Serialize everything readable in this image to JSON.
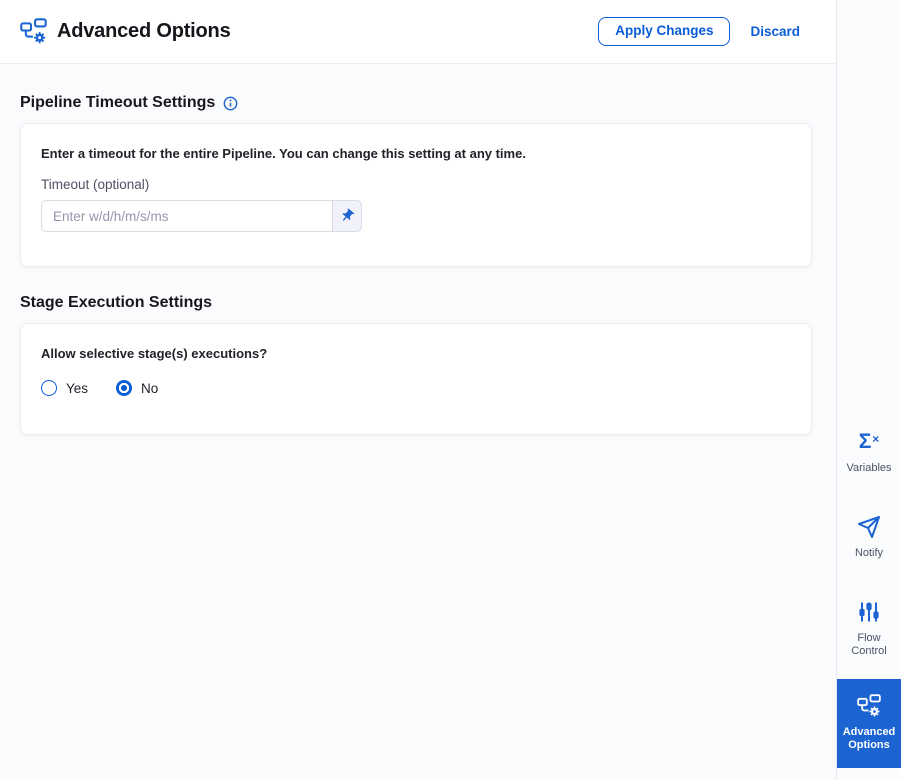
{
  "header": {
    "title": "Advanced Options",
    "icon": "pipeline-gear-icon",
    "apply_label": "Apply Changes",
    "discard_label": "Discard"
  },
  "pipeline_timeout": {
    "heading": "Pipeline Timeout Settings",
    "info_icon": "info-icon",
    "description": "Enter a timeout for the entire Pipeline. You can change this setting at any time.",
    "timeout_label": "Timeout (optional)",
    "timeout_placeholder": "Enter w/d/h/m/s/ms",
    "timeout_value": "",
    "value_type_icon": "pin-icon"
  },
  "stage_execution": {
    "heading": "Stage Execution Settings",
    "question": "Allow selective stage(s) executions?",
    "options": [
      {
        "label": "Yes",
        "selected": false
      },
      {
        "label": "No",
        "selected": true
      }
    ]
  },
  "sidebar": {
    "items": [
      {
        "label": "Variables",
        "icon": "sigma-x-icon",
        "selected": false
      },
      {
        "label": "Notify",
        "icon": "paper-plane-icon",
        "selected": false
      },
      {
        "label": "Flow Control",
        "icon": "sliders-icon",
        "selected": false
      },
      {
        "label": "Advanced Options",
        "icon": "pipeline-gear-icon",
        "selected": true
      }
    ]
  },
  "colors": {
    "accent_blue": "#1b64d2",
    "action_blue": "#0b5cd7",
    "page_background": "#fafbfc",
    "card_background": "#ffffff",
    "border": "#ebedf2"
  }
}
